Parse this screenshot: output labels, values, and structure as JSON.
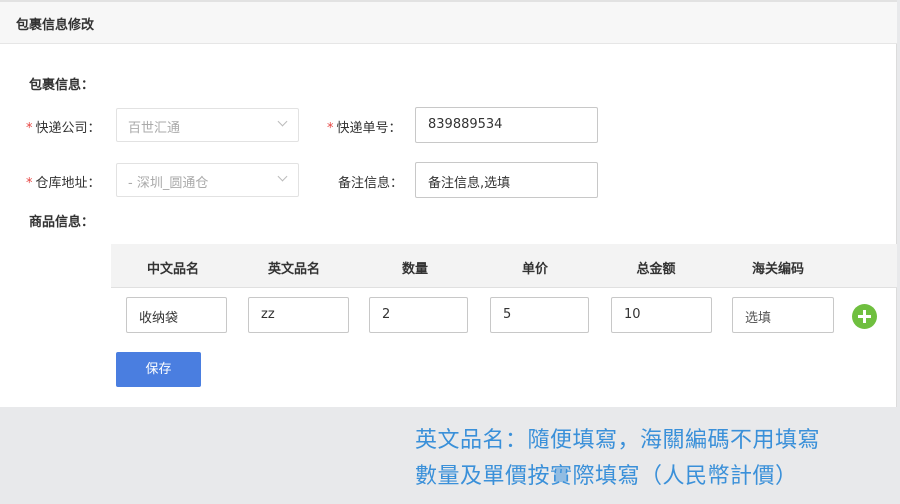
{
  "header": {
    "title": "包裹信息修改"
  },
  "package_section": {
    "label": "包裹信息："
  },
  "form": {
    "required_mark": "*",
    "courier": {
      "label": "快递公司：",
      "value": "百世汇通"
    },
    "tracking": {
      "label": "快递单号：",
      "value": "839889534"
    },
    "warehouse": {
      "label": "仓库地址：",
      "value": "- 深圳_圆通仓"
    },
    "remark": {
      "label": "备注信息：",
      "value": "备注信息,选填"
    }
  },
  "goods_section": {
    "label": "商品信息："
  },
  "table": {
    "headers": [
      "中文品名",
      "英文品名",
      "数量",
      "单价",
      "总金额",
      "海关编码"
    ],
    "row": [
      "收纳袋",
      "zz",
      "2",
      "5",
      "10",
      "选填"
    ]
  },
  "save_label": "保存",
  "notes": [
    "英文品名：隨便填寫，海關編碼不用填寫",
    "數量及單價按實際填寫（人民幣計價）"
  ],
  "colors": {
    "accent": "#4a7ee0",
    "required": "#e64340",
    "add": "#6fbf3f",
    "note": "#3a90d9"
  }
}
